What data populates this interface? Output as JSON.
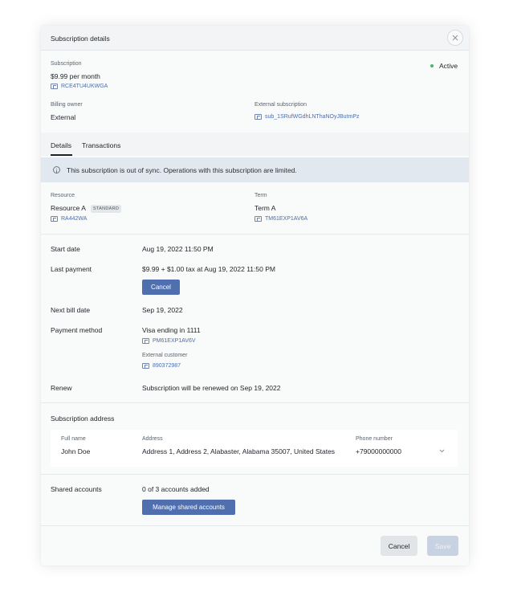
{
  "header": {
    "title": "Subscription details"
  },
  "subscription": {
    "label": "Subscription",
    "price": "$9.99 per month",
    "id": "RCE4TU4UKWGA",
    "status": "Active",
    "status_color": "#4bb36e"
  },
  "billing": {
    "owner_label": "Billing owner",
    "owner_value": "External",
    "external_label": "External subscription",
    "external_id": "sub_1SRufWGdhLNThaNOyJButmPz"
  },
  "tabs": [
    {
      "label": "Details",
      "active": true
    },
    {
      "label": "Transactions",
      "active": false
    }
  ],
  "alert": {
    "text": "This subscription is out of sync. Operations with this subscription are limited."
  },
  "resource": {
    "label": "Resource",
    "name": "Resource A",
    "badge": "STANDARD",
    "id": "RA442WA"
  },
  "term": {
    "label": "Term",
    "name": "Term A",
    "id": "TM61EXP1AV6A"
  },
  "details": {
    "start_label": "Start date",
    "start_value": "Aug 19, 2022 11:50 PM",
    "last_payment_label": "Last payment",
    "last_payment_value": "$9.99 + $1.00 tax at Aug 19, 2022 11:50 PM",
    "cancel_label": "Cancel",
    "next_bill_label": "Next bill date",
    "next_bill_value": "Sep 19, 2022",
    "payment_method_label": "Payment method",
    "payment_method_value": "Visa ending in 1111",
    "payment_method_id": "PM61EXP1AV6V",
    "external_customer_label": "External customer",
    "external_customer_id": "890372987",
    "renew_label": "Renew",
    "renew_value": "Subscription will be renewed on Sep 19, 2022"
  },
  "address": {
    "section_title": "Subscription address",
    "full_name_label": "Full name",
    "full_name_value": "John Doe",
    "address_label": "Address",
    "address_value": "Address 1, Address 2, Alabaster, Alabama 35007, United States",
    "phone_label": "Phone number",
    "phone_value": "+79000000000"
  },
  "shared": {
    "label": "Shared accounts",
    "value": "0 of 3 accounts added",
    "manage_label": "Manage shared accounts"
  },
  "footer": {
    "cancel_label": "Cancel",
    "save_label": "Save"
  },
  "colors": {
    "accent": "#4f6fae",
    "link": "#4e6da8",
    "alert_bg": "#e2e8ef"
  }
}
